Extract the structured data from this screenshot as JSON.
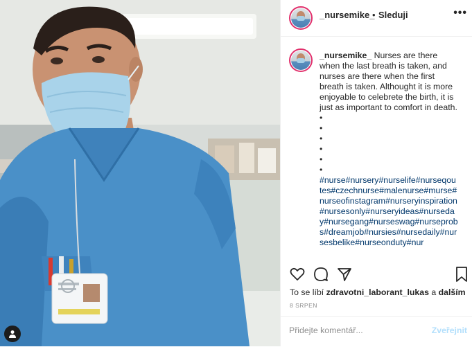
{
  "post": {
    "username": "_nursemike_",
    "separator": "•",
    "follow_label": "Sleduji",
    "more_label": "•••"
  },
  "caption": {
    "username": "_nursemike_",
    "text": "Nurses are there when the last breath is taken, and nurses are there when the first breath is taken. Althought it is more enjoyable to celebrete the birth, it is just as important to comfort in death.",
    "bullets": [
      "•",
      "•",
      "•",
      "•",
      "•",
      "•"
    ],
    "hashtags": "#nurse#nursery#nurselife#nurseqoutes#czechnurse#malenurse#murse#nurseofinstagram#nurseryinspiration#nursesonly#nurseryideas#nurseday#nursegang#nurseswag#nurseprobs#dreamjob#nursies#nursedaily#nursesbelike#nurseonduty#nur"
  },
  "actions": {
    "like_icon": "heart-icon",
    "comment_icon": "comment-icon",
    "share_icon": "share-icon",
    "save_icon": "bookmark-icon"
  },
  "likes": {
    "prefix": "To se líbí",
    "user": "zdravotni_laborant_lukas",
    "conj": "a",
    "others": "dalším"
  },
  "date": "8 SRPEN",
  "comment_box": {
    "placeholder": "Přidejte komentář...",
    "post_label": "Zveřejnit"
  },
  "colors": {
    "link": "#00376b",
    "post_disabled": "#b2dffc",
    "ring": "#e1306c",
    "scrub": "#4a90c8"
  }
}
